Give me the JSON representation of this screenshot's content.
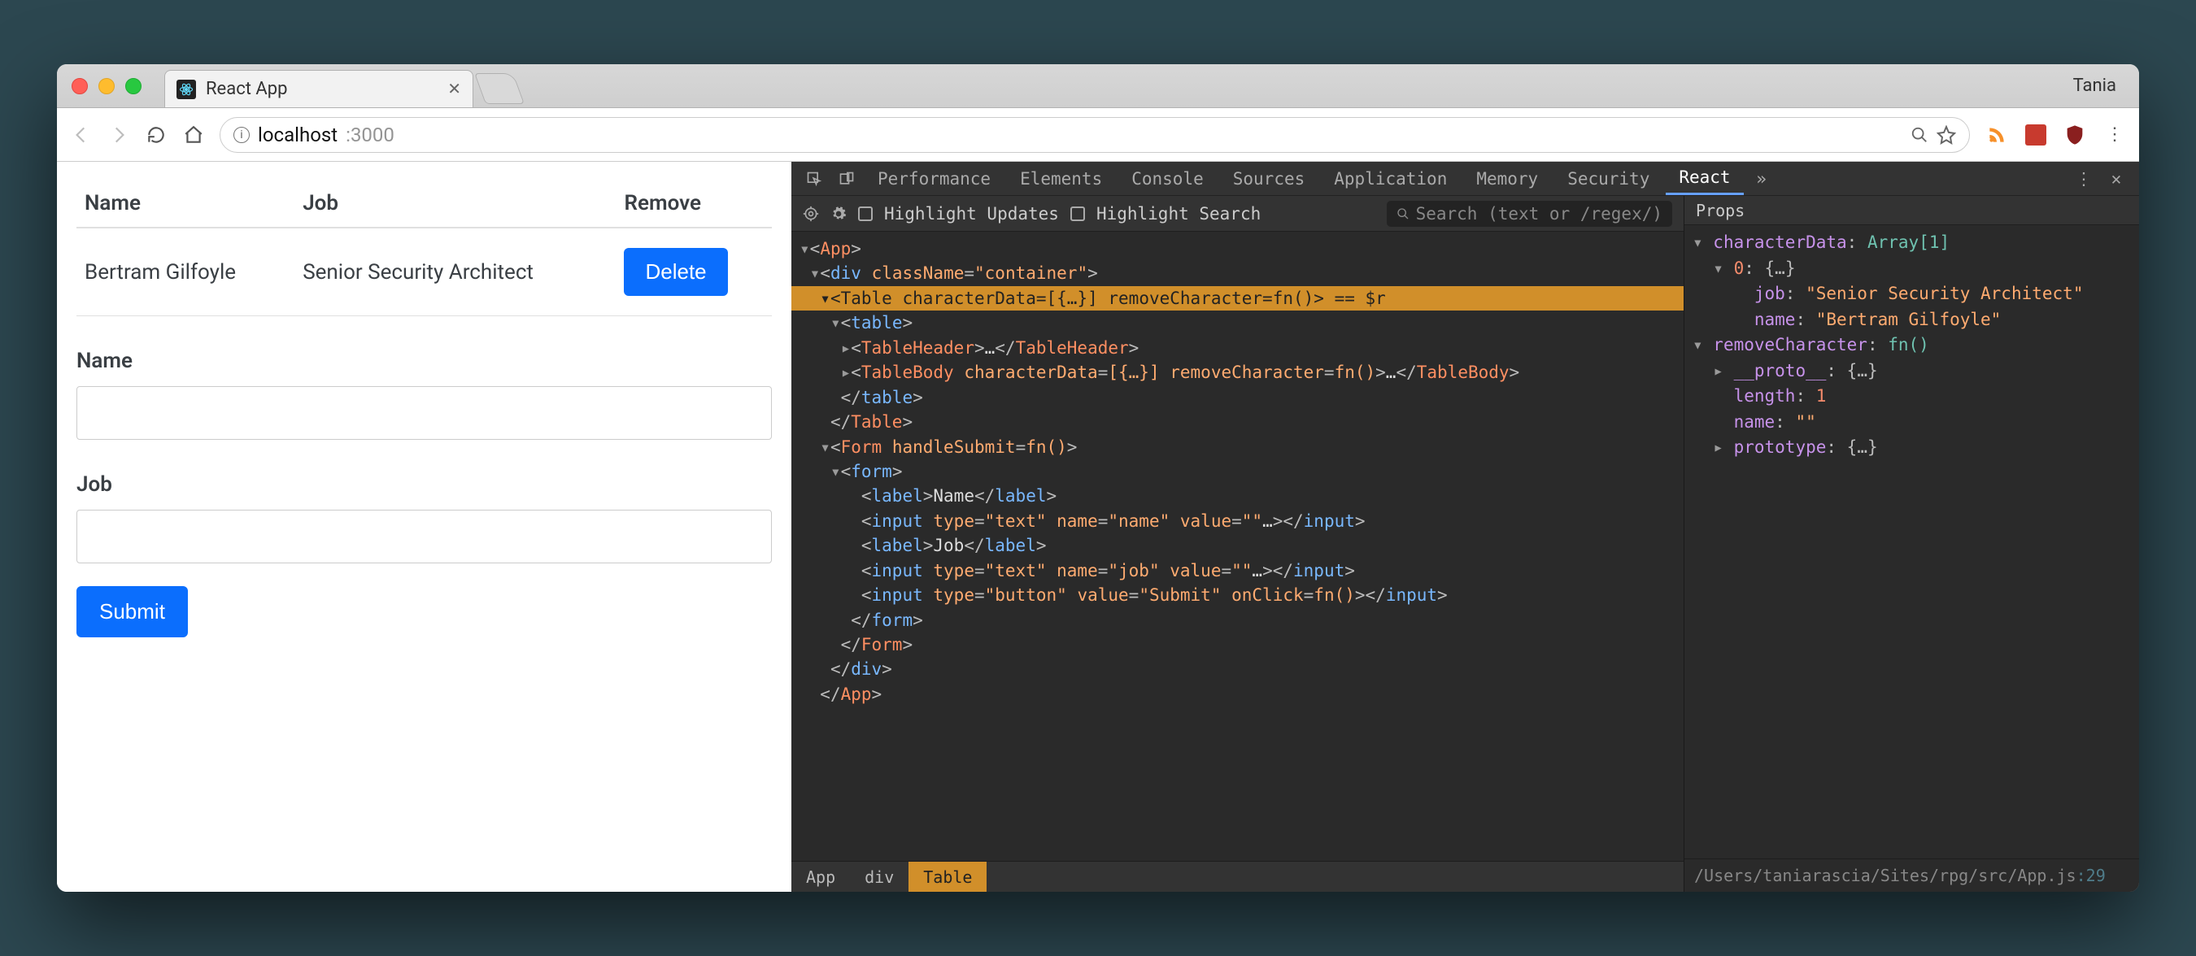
{
  "browser": {
    "tab_title": "React App",
    "user_profile": "Tania",
    "url_host": "localhost",
    "url_port": ":3000"
  },
  "devtools": {
    "tabs": [
      "Performance",
      "Elements",
      "Console",
      "Sources",
      "Application",
      "Memory",
      "Security",
      "React"
    ],
    "active_tab": "React",
    "toolbar": {
      "highlight_updates": "Highlight Updates",
      "highlight_search": "Highlight Search",
      "search_placeholder": "Search (text or /regex/)"
    },
    "props_header": "Props",
    "props": {
      "line0": "▾ characterData: Array[1]",
      "line1": "  ▾ 0: {…}",
      "line2": "      job: \"Senior Security Architect\"",
      "line3": "      name: \"Bertram Gilfoyle\"",
      "line4": "▾ removeCharacter: fn()",
      "line5": "  ▸ __proto__: {…}",
      "line6": "    length: 1",
      "line7": "    name: \"\"",
      "line8": "  ▸ prototype: {…}"
    },
    "tree": {
      "l0": "▾<App>",
      "l1": " ▾<div className=\"container\">",
      "l2": "  ▾<Table characterData=[{…}] removeCharacter=fn()> == $r",
      "l3": "   ▾<table>",
      "l4": "    ▸<TableHeader>…</TableHeader>",
      "l5": "    ▸<TableBody characterData=[{…}] removeCharacter=fn()>…</TableBody>",
      "l6": "    </table>",
      "l7": "   </Table>",
      "l8": "  ▾<Form handleSubmit=fn()>",
      "l9": "   ▾<form>",
      "l10": "      <label>Name</label>",
      "l11": "      <input type=\"text\" name=\"name\" value=\"\"…></input>",
      "l12": "      <label>Job</label>",
      "l13": "      <input type=\"text\" name=\"job\" value=\"\"…></input>",
      "l14": "      <input type=\"button\" value=\"Submit\" onClick=fn()></input>",
      "l15": "     </form>",
      "l16": "    </Form>",
      "l17": "   </div>",
      "l18": "  </App>"
    },
    "breadcrumbs": [
      "App",
      "div",
      "Table"
    ],
    "source_path": "/Users/taniarascia/Sites/rpg/src/App.js",
    "source_line": ":29"
  },
  "app": {
    "columns": {
      "name": "Name",
      "job": "Job",
      "remove": "Remove"
    },
    "rows": [
      {
        "name": "Bertram Gilfoyle",
        "job": "Senior Security Architect"
      }
    ],
    "delete_label": "Delete",
    "form": {
      "name_label": "Name",
      "job_label": "Job",
      "submit_label": "Submit"
    }
  }
}
